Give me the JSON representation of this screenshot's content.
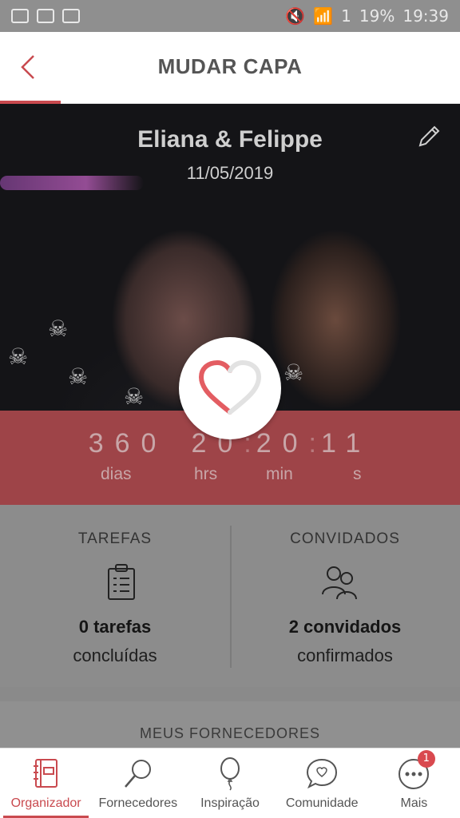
{
  "status_bar": {
    "battery": "19%",
    "time": "19:39",
    "sim": "1"
  },
  "header": {
    "title": "MUDAR CAPA"
  },
  "cover": {
    "names": "Eliana & Felippe",
    "date": "11/05/2019"
  },
  "countdown": {
    "days": "360",
    "hours": "20",
    "minutes": "20",
    "seconds": "11",
    "labels": {
      "days": "dias",
      "hours": "hrs",
      "minutes": "min",
      "seconds": "s"
    }
  },
  "stats": {
    "tasks": {
      "label": "TAREFAS",
      "count": "0 tarefas",
      "sub": "concluídas"
    },
    "guests": {
      "label": "CONVIDADOS",
      "count": "2 convidados",
      "sub": "confirmados"
    }
  },
  "suppliers": {
    "title": "MEUS FORNECEDORES"
  },
  "bottom_nav": [
    {
      "label": "Organizador",
      "icon": "notebook-icon",
      "active": true
    },
    {
      "label": "Fornecedores",
      "icon": "search-icon",
      "active": false
    },
    {
      "label": "Inspiração",
      "icon": "balloon-icon",
      "active": false
    },
    {
      "label": "Comunidade",
      "icon": "chat-heart-icon",
      "active": false
    },
    {
      "label": "Mais",
      "icon": "more-icon",
      "active": false,
      "badge": "1"
    }
  ],
  "colors": {
    "accent": "#c94a4f",
    "countdown_bg": "#9e4448"
  }
}
